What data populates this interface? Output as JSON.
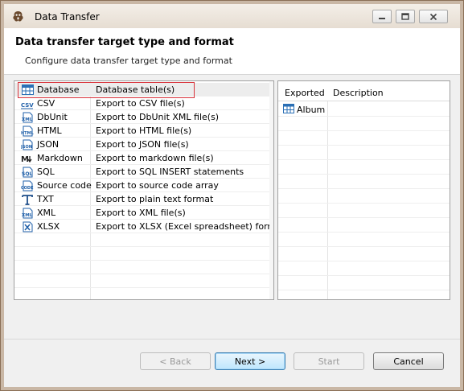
{
  "window": {
    "title": "Data Transfer"
  },
  "header": {
    "title": "Data transfer target type and format",
    "subtitle": "Configure data transfer target type and format"
  },
  "formats": [
    {
      "name": "Database",
      "description": "Database table(s)",
      "icon": "database-table-icon"
    },
    {
      "name": "CSV",
      "description": "Export to CSV file(s)",
      "icon": "csv-icon"
    },
    {
      "name": "DbUnit",
      "description": "Export to DbUnit XML file(s)",
      "icon": "xml-icon"
    },
    {
      "name": "HTML",
      "description": "Export to HTML file(s)",
      "icon": "html-icon"
    },
    {
      "name": "JSON",
      "description": "Export to JSON file(s)",
      "icon": "json-icon"
    },
    {
      "name": "Markdown",
      "description": "Export to markdown file(s)",
      "icon": "markdown-icon"
    },
    {
      "name": "SQL",
      "description": "Export to SQL INSERT statements",
      "icon": "sql-icon"
    },
    {
      "name": "Source code",
      "description": "Export to source code array",
      "icon": "code-icon"
    },
    {
      "name": "TXT",
      "description": "Export to plain text format",
      "icon": "text-icon"
    },
    {
      "name": "XML",
      "description": "Export to XML file(s)",
      "icon": "xml-icon"
    },
    {
      "name": "XLSX",
      "description": "Export to XLSX (Excel spreadsheet) format",
      "icon": "excel-icon"
    }
  ],
  "exported": {
    "columns": [
      "Exported",
      "Description"
    ],
    "rows": [
      {
        "name": "Album",
        "description": "",
        "icon": "table-icon"
      }
    ]
  },
  "buttons": {
    "back": "< Back",
    "next": "Next >",
    "start": "Start",
    "cancel": "Cancel"
  },
  "colors": {
    "highlight": "#d9343c",
    "table_icon": "#2a6fb5"
  }
}
